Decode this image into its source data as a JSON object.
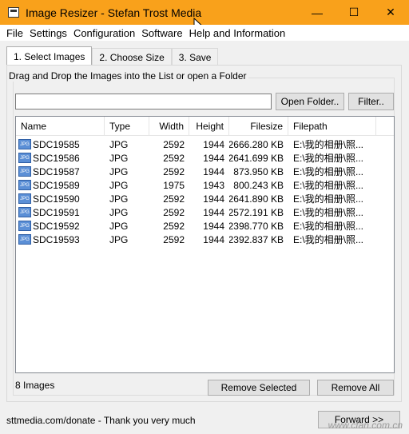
{
  "window": {
    "title": "Image Resizer - Stefan Trost Media",
    "minimize": "—",
    "maximize": "☐",
    "close": "✕"
  },
  "menu": [
    "File",
    "Settings",
    "Configuration",
    "Software",
    "Help and Information"
  ],
  "tabs": [
    {
      "label": "1. Select Images",
      "active": true
    },
    {
      "label": "2. Choose Size",
      "active": false
    },
    {
      "label": "3. Save",
      "active": false
    }
  ],
  "group_title": "Drag and Drop the Images into the List or open a Folder",
  "path_input": {
    "value": "",
    "placeholder": ""
  },
  "buttons": {
    "open_folder": "Open Folder..",
    "filter": "Filter..",
    "remove_selected": "Remove Selected",
    "remove_all": "Remove All",
    "forward": "Forward >>"
  },
  "columns": [
    "Name",
    "Type",
    "Width",
    "Height",
    "Filesize",
    "Filepath"
  ],
  "rows": [
    {
      "name": "SDC19585",
      "type": "JPG",
      "width": "2592",
      "height": "1944",
      "filesize": "2666.280 KB",
      "filepath": "E:\\我的相册\\照..."
    },
    {
      "name": "SDC19586",
      "type": "JPG",
      "width": "2592",
      "height": "1944",
      "filesize": "2641.699 KB",
      "filepath": "E:\\我的相册\\照..."
    },
    {
      "name": "SDC19587",
      "type": "JPG",
      "width": "2592",
      "height": "1944",
      "filesize": "873.950 KB",
      "filepath": "E:\\我的相册\\照..."
    },
    {
      "name": "SDC19589",
      "type": "JPG",
      "width": "1975",
      "height": "1943",
      "filesize": "800.243 KB",
      "filepath": "E:\\我的相册\\照..."
    },
    {
      "name": "SDC19590",
      "type": "JPG",
      "width": "2592",
      "height": "1944",
      "filesize": "2641.890 KB",
      "filepath": "E:\\我的相册\\照..."
    },
    {
      "name": "SDC19591",
      "type": "JPG",
      "width": "2592",
      "height": "1944",
      "filesize": "2572.191 KB",
      "filepath": "E:\\我的相册\\照..."
    },
    {
      "name": "SDC19592",
      "type": "JPG",
      "width": "2592",
      "height": "1944",
      "filesize": "2398.770 KB",
      "filepath": "E:\\我的相册\\照..."
    },
    {
      "name": "SDC19593",
      "type": "JPG",
      "width": "2592",
      "height": "1944",
      "filesize": "2392.837 KB",
      "filepath": "E:\\我的相册\\照..."
    }
  ],
  "row_icon_label": "JPG",
  "image_count": "8 Images",
  "footer": "sttmedia.com/donate - Thank you very much",
  "watermark": "www.cfan.com.cn",
  "colors": {
    "titlebar": "#f9a11b"
  }
}
